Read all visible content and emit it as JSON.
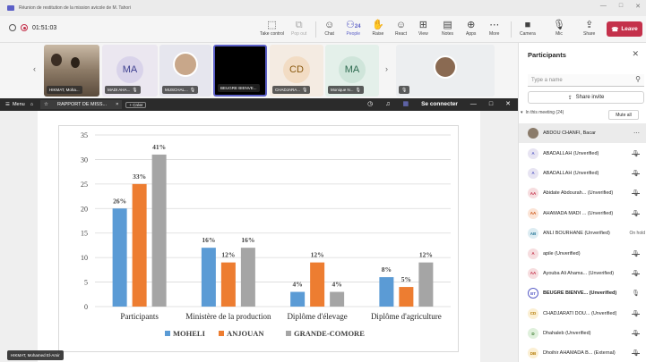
{
  "window": {
    "title": "Réunion de restitution de la mission avicole de M. Tahori",
    "controls": [
      "—",
      "□",
      "✕"
    ]
  },
  "meeting": {
    "timer": "01:51:03",
    "toolbar": [
      {
        "label": "Take control",
        "icon": "take-control-icon",
        "glyph": "⬚"
      },
      {
        "label": "Pop out",
        "icon": "pop-out-icon",
        "glyph": "⧉"
      },
      {
        "label": "Chat",
        "icon": "chat-icon",
        "glyph": "☺"
      },
      {
        "label": "People",
        "icon": "people-icon",
        "glyph": "⚇",
        "count": "24"
      },
      {
        "label": "Raise",
        "icon": "raise-hand-icon",
        "glyph": "✋"
      },
      {
        "label": "React",
        "icon": "react-icon",
        "glyph": "☺"
      },
      {
        "label": "View",
        "icon": "view-icon",
        "glyph": "⊞"
      },
      {
        "label": "Notes",
        "icon": "notes-icon",
        "glyph": "▤"
      },
      {
        "label": "Apps",
        "icon": "apps-icon",
        "glyph": "⊕"
      },
      {
        "label": "More",
        "icon": "more-icon",
        "glyph": "⋯"
      },
      {
        "label": "Camera",
        "icon": "camera-off-icon",
        "glyph": "■"
      },
      {
        "label": "Mic",
        "icon": "mic-off-icon",
        "glyph": "🎙"
      },
      {
        "label": "Share",
        "icon": "share-icon",
        "glyph": "⇪"
      }
    ],
    "leave_label": "Leave"
  },
  "tiles": [
    {
      "name": "HIKMAT, Moha...",
      "type": "photo"
    },
    {
      "name": "MADI AHA...",
      "initials": "MA",
      "bg": "#e8e3ef"
    },
    {
      "name": "MUSCHAL...",
      "type": "face"
    },
    {
      "name": "BEUGRE BIENVE...",
      "type": "black"
    },
    {
      "name": "CHADJARA...",
      "initials": "CD",
      "bg": "#f2e2d4"
    },
    {
      "name": "Monique N...",
      "initials": "MA",
      "bg": "#e1eee9"
    },
    {
      "name": "",
      "type": "face2"
    }
  ],
  "share_bar": {
    "menu": "Menu",
    "tab_title": "RAPPORT DE MISS...",
    "new_tab": "+ Créer",
    "connect": "Se connecter"
  },
  "presenter": "HIKMAT, Mohamed El-Amir",
  "panel": {
    "title": "Participants",
    "search_placeholder": "Type a name",
    "share_invite": "Share invite",
    "in_meeting": "In this meeting (24)",
    "mute_all": "Mute all",
    "participants": [
      {
        "name": "ABDOU CHANFI, Bacar",
        "initials": "",
        "bg": "#8a7b6a",
        "color": "#fff",
        "status": "more"
      },
      {
        "name": "ABADALLAH (Unverified)",
        "initials": "A",
        "bg": "#e7e4f2",
        "color": "#5b5fc7",
        "status": "mic-off"
      },
      {
        "name": "ABADALLAH (Unverified)",
        "initials": "A",
        "bg": "#e7e4f2",
        "color": "#5b5fc7",
        "status": "mic-off"
      },
      {
        "name": "Abidate Abdourah... (Unverified)",
        "initials": "AA",
        "bg": "#f6dddf",
        "color": "#c4314b",
        "status": "mic-off"
      },
      {
        "name": "AHAMADA MADI ... (Unverified)",
        "initials": "AA",
        "bg": "#fbe4d6",
        "color": "#ca5010",
        "status": "mic-off"
      },
      {
        "name": "ANLI BOURHANE (Unverified)",
        "initials": "AB",
        "bg": "#dcecf2",
        "color": "#2b7a9a",
        "status": "On hold"
      },
      {
        "name": "apile (Unverified)",
        "initials": "A",
        "bg": "#f6dddf",
        "color": "#c4314b",
        "status": "mic-off"
      },
      {
        "name": "Ayouba Ali Ahama... (Unverified)",
        "initials": "AA",
        "bg": "#f6dddf",
        "color": "#c4314b",
        "status": "mic-off"
      },
      {
        "name": "BEUGRE BIENVE... (Unverified)",
        "initials": "BT",
        "bg": "#ffffff",
        "color": "#5b5fc7",
        "status": "mic-on",
        "bold": true
      },
      {
        "name": "CHADJARATI DOU... (Unverified)",
        "initials": "CD",
        "bg": "#fbefd3",
        "color": "#b27800",
        "status": "mic-off"
      },
      {
        "name": "Dhahaleb (Unverified)",
        "initials": "D",
        "bg": "#dff0dc",
        "color": "#3b7a2e",
        "status": "mic-off"
      },
      {
        "name": "Dhoihir AHAMADA B... (External)",
        "initials": "DB",
        "bg": "#fbefd3",
        "color": "#b27800",
        "status": "mic-off"
      }
    ]
  },
  "chart_data": {
    "type": "bar",
    "categories": [
      "Participants",
      "Ministère de la production",
      "Diplôme d'élevage",
      "Diplôme d'agriculture"
    ],
    "series": [
      {
        "name": "MOHELI",
        "color": "#5b9bd5",
        "values": [
          20,
          12,
          3,
          6
        ],
        "labels": [
          "26%",
          "16%",
          "4%",
          "8%"
        ]
      },
      {
        "name": "ANJOUAN",
        "color": "#ed7d31",
        "values": [
          25,
          9,
          9,
          4
        ],
        "labels": [
          "33%",
          "12%",
          "12%",
          "5%"
        ]
      },
      {
        "name": "GRANDE-COMORE",
        "color": "#a5a5a5",
        "values": [
          31,
          12,
          3,
          9
        ],
        "labels": [
          "41%",
          "16%",
          "4%",
          "12%"
        ]
      }
    ],
    "yticks": [
      0,
      5,
      10,
      15,
      20,
      25,
      30,
      35
    ],
    "ylim": [
      0,
      35
    ],
    "grid": true,
    "legend": "bottom"
  }
}
